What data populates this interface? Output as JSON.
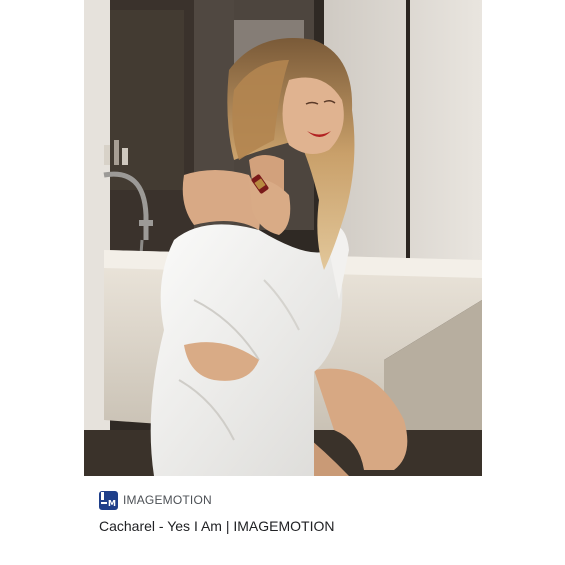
{
  "result": {
    "image_alt": "Woman in white bathrobe sitting on bathtub edge holding lipstick",
    "source": {
      "favicon_icon": "imagemotion-logo-icon",
      "favicon_letter": "M",
      "name": "IMAGEMOTION"
    },
    "title": "Cacharel - Yes I Am | IMAGEMOTION"
  },
  "colors": {
    "favicon_bg": "#1f3f8a",
    "title_text": "#202124",
    "source_text": "#4d5156"
  }
}
